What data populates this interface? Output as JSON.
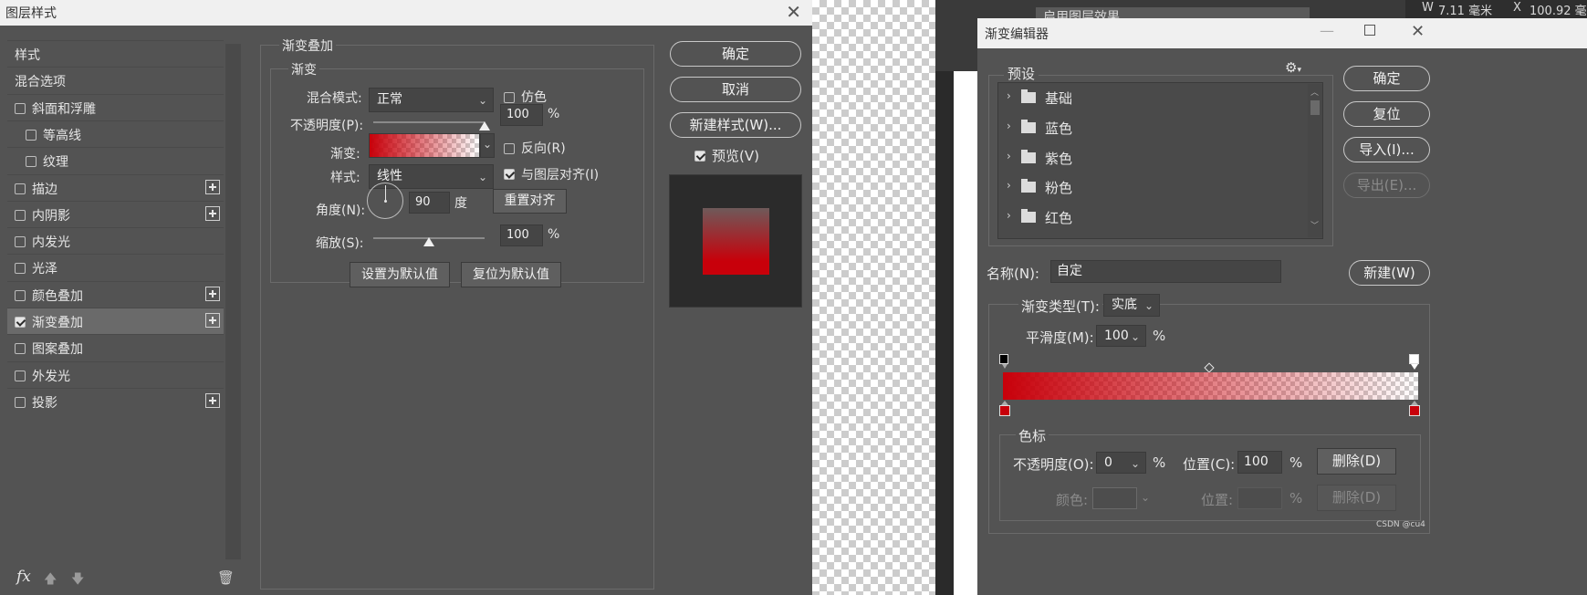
{
  "layer_style_dialog": {
    "title": "图层样式",
    "styles_list": {
      "items": [
        {
          "label": "样式",
          "checkbox": false,
          "checked": false,
          "indent": false,
          "plus": false,
          "selected": false
        },
        {
          "label": "混合选项",
          "checkbox": false,
          "checked": false,
          "indent": false,
          "plus": false,
          "selected": false
        },
        {
          "label": "斜面和浮雕",
          "checkbox": true,
          "checked": false,
          "indent": false,
          "plus": false,
          "selected": false
        },
        {
          "label": "等高线",
          "checkbox": true,
          "checked": false,
          "indent": true,
          "plus": false,
          "selected": false
        },
        {
          "label": "纹理",
          "checkbox": true,
          "checked": false,
          "indent": true,
          "plus": false,
          "selected": false
        },
        {
          "label": "描边",
          "checkbox": true,
          "checked": false,
          "indent": false,
          "plus": true,
          "selected": false
        },
        {
          "label": "内阴影",
          "checkbox": true,
          "checked": false,
          "indent": false,
          "plus": true,
          "selected": false
        },
        {
          "label": "内发光",
          "checkbox": true,
          "checked": false,
          "indent": false,
          "plus": false,
          "selected": false
        },
        {
          "label": "光泽",
          "checkbox": true,
          "checked": false,
          "indent": false,
          "plus": false,
          "selected": false
        },
        {
          "label": "颜色叠加",
          "checkbox": true,
          "checked": false,
          "indent": false,
          "plus": true,
          "selected": false
        },
        {
          "label": "渐变叠加",
          "checkbox": true,
          "checked": true,
          "indent": false,
          "plus": true,
          "selected": true
        },
        {
          "label": "图案叠加",
          "checkbox": true,
          "checked": false,
          "indent": false,
          "plus": false,
          "selected": false
        },
        {
          "label": "外发光",
          "checkbox": true,
          "checked": false,
          "indent": false,
          "plus": false,
          "selected": false
        },
        {
          "label": "投影",
          "checkbox": true,
          "checked": false,
          "indent": false,
          "plus": true,
          "selected": false
        }
      ],
      "footer_fx": "fx"
    },
    "gradient_overlay": {
      "section_title": "渐变叠加",
      "subsection_title": "渐变",
      "blend_mode_label": "混合模式:",
      "blend_mode_value": "正常",
      "dither_label": "仿色",
      "opacity_label": "不透明度(P):",
      "opacity_value": "100",
      "opacity_unit": "%",
      "opacity_level": 100,
      "gradient_label": "渐变:",
      "reverse_label": "反向(R)",
      "style_label": "样式:",
      "style_value": "线性",
      "align_label": "与图层对齐(I)",
      "angle_label": "角度(N):",
      "angle_value": "90",
      "angle_unit": "度",
      "reset_align_label": "重置对齐",
      "scale_label": "缩放(S):",
      "scale_value": "100",
      "scale_unit": "%",
      "scale_level": 0.5,
      "set_default_label": "设置为默认值",
      "reset_default_label": "复位为默认值"
    },
    "buttons": {
      "ok": "确定",
      "cancel": "取消",
      "new_style": "新建样式(W)...",
      "preview": "预览(V)"
    },
    "colors": {
      "gradient_red": "#c8000a",
      "preview_top": "#6e5a5a",
      "preview_bottom": "#c8000a"
    }
  },
  "background_app": {
    "partial_layer_text": "启用图层效果",
    "w_label": "W",
    "w_value": "7.11 毫米",
    "x_label": "X",
    "x_value": "100.92 毫"
  },
  "gradient_editor": {
    "title": "渐变编辑器",
    "presets_label": "预设",
    "preset_folders": [
      "基础",
      "蓝色",
      "紫色",
      "粉色",
      "红色"
    ],
    "buttons": {
      "ok": "确定",
      "reset": "复位",
      "import": "导入(I)...",
      "export": "导出(E)...",
      "new": "新建(W)"
    },
    "name_label": "名称(N):",
    "name_value": "自定",
    "gradient_type_label": "渐变类型(T):",
    "gradient_type_value": "实底",
    "smoothness_label": "平滑度(M):",
    "smoothness_value": "100",
    "smoothness_unit": "%",
    "color_stops_label": "色标",
    "opacity_label": "不透明度(O):",
    "opacity_value": "0",
    "opacity_unit": "%",
    "position_label": "位置(C):",
    "position_value": "100",
    "position_unit": "%",
    "delete_label": "删除(D)",
    "color_label": "颜色:",
    "position2_label": "位置:",
    "position2_unit": "%",
    "delete2_label": "删除(D)"
  },
  "watermark": "CSDN @cu4"
}
